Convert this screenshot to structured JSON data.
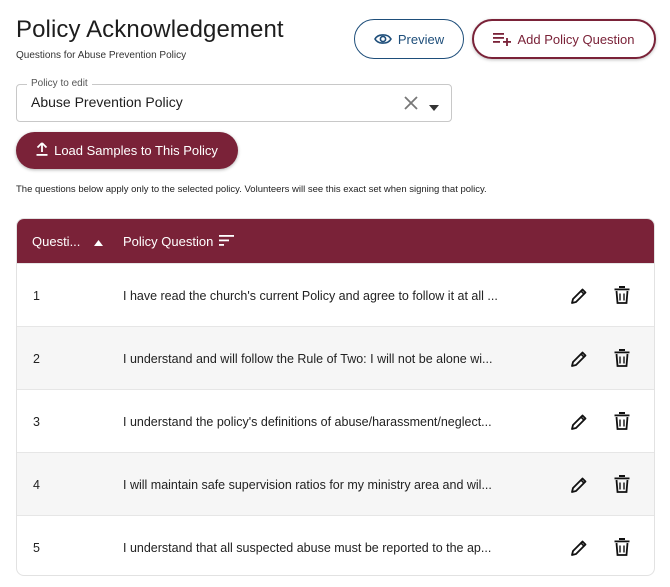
{
  "header": {
    "title": "Policy Acknowledgement",
    "subtitle": "Questions for Abuse Prevention Policy",
    "preview_label": "Preview",
    "add_label": "Add Policy Question"
  },
  "policy_select": {
    "label": "Policy to edit",
    "value": "Abuse Prevention Policy"
  },
  "load_samples_label": "Load Samples to This Policy",
  "note": "The questions below apply only to the selected policy. Volunteers will see this exact set when signing that policy.",
  "table": {
    "columns": [
      "Questi...",
      "Policy Question"
    ],
    "rows": [
      {
        "num": "1",
        "question": "I have read the church's current Policy and agree to follow it at all ..."
      },
      {
        "num": "2",
        "question": "I understand and will follow the Rule of Two: I will not be alone wi..."
      },
      {
        "num": "3",
        "question": "I understand the policy's definitions of abuse/harassment/neglect..."
      },
      {
        "num": "4",
        "question": "I will maintain safe supervision ratios for my ministry area and wil..."
      },
      {
        "num": "5",
        "question": "I understand that all suspected abuse must be reported to the ap..."
      }
    ]
  },
  "icons": {
    "preview": "eye-icon",
    "add": "playlist-add-icon",
    "clear": "close-icon",
    "dropdown": "caret-down-icon",
    "load": "upload-icon",
    "sort": "sort-ascending-icon",
    "filter": "sort-lines-icon",
    "edit": "pencil-icon",
    "delete": "trash-icon"
  },
  "colors": {
    "brand": "#7a2238",
    "preview_accent": "#1e4e7a"
  }
}
